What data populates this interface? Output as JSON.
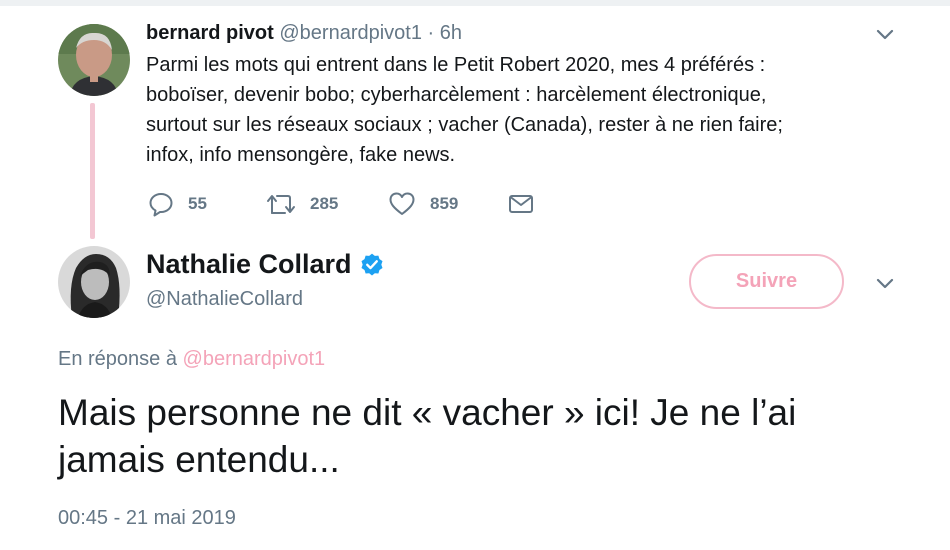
{
  "parent_tweet": {
    "author_name": "bernard pivot",
    "author_handle": "@bernardpivot1",
    "separator": "·",
    "time": "6h",
    "text_lines": [
      "Parmi les mots qui entrent dans le Petit Robert 2020, mes 4 préférés :",
      "boboïser, devenir bobo; cyberharcèlement : harcèlement électronique,",
      "surtout sur les réseaux sociaux ; vacher (Canada), rester à ne rien faire;",
      "infox, info mensongère, fake news."
    ],
    "actions": {
      "reply_count": "55",
      "retweet_count": "285",
      "like_count": "859"
    }
  },
  "main_tweet": {
    "author_name": "Nathalie Collard",
    "author_handle": "@NathalieCollard",
    "follow_label": "Suivre",
    "reply_prefix": "En réponse à",
    "reply_mention": "@bernardpivot1",
    "text_lines": [
      "Mais personne ne dit « vacher » ici! Je ne l’ai",
      "jamais entendu..."
    ],
    "timestamp": "00:45 - 21 mai 2019"
  },
  "icons": {
    "reply": "reply-icon",
    "retweet": "retweet-icon",
    "like": "heart-icon",
    "dm": "envelope-icon",
    "verified": "verified-badge-icon",
    "caret": "chevron-down-icon"
  },
  "colors": {
    "accent_pink": "#f4a3b8",
    "thread_line": "#f3c7d3",
    "verified_blue": "#1da1f2",
    "secondary_text": "#657786"
  }
}
